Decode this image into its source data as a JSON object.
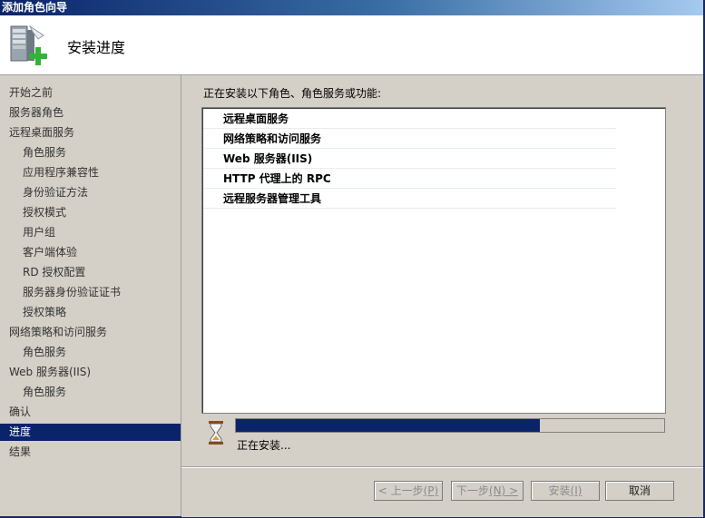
{
  "window": {
    "title": "添加角色向导"
  },
  "header": {
    "title": "安装进度"
  },
  "sidebar": {
    "items": [
      {
        "label": "开始之前"
      },
      {
        "label": "服务器角色"
      },
      {
        "label": "远程桌面服务"
      },
      {
        "label": "角色服务"
      },
      {
        "label": "应用程序兼容性"
      },
      {
        "label": "身份验证方法"
      },
      {
        "label": "授权模式"
      },
      {
        "label": "用户组"
      },
      {
        "label": "客户端体验"
      },
      {
        "label": "RD 授权配置"
      },
      {
        "label": "服务器身份验证证书"
      },
      {
        "label": "授权策略"
      },
      {
        "label": "网络策略和访问服务"
      },
      {
        "label": "角色服务"
      },
      {
        "label": "Web 服务器(IIS)"
      },
      {
        "label": "角色服务"
      },
      {
        "label": "确认"
      },
      {
        "label": "进度",
        "selected": true
      },
      {
        "label": "结果"
      }
    ]
  },
  "main": {
    "intro": "正在安装以下角色、角色服务或功能:",
    "list": [
      "远程桌面服务",
      "网络策略和访问服务",
      "Web 服务器(IIS)",
      "HTTP 代理上的 RPC",
      "远程服务器管理工具"
    ],
    "progress_fraction": 0.71,
    "status": "正在安装..."
  },
  "footer": {
    "prev": {
      "label": "< 上一步",
      "key": "(P)"
    },
    "next": {
      "label": "下一步",
      "key": "(N) >"
    },
    "install": {
      "label": "安装",
      "key": "(I)"
    },
    "cancel": {
      "label": "取消"
    }
  },
  "colors": {
    "selection": "#0a246a",
    "progress": "#0a246a",
    "titlebar": "#0a246a"
  },
  "icons": {
    "header": "server-add-icon",
    "status": "hourglass-icon"
  }
}
